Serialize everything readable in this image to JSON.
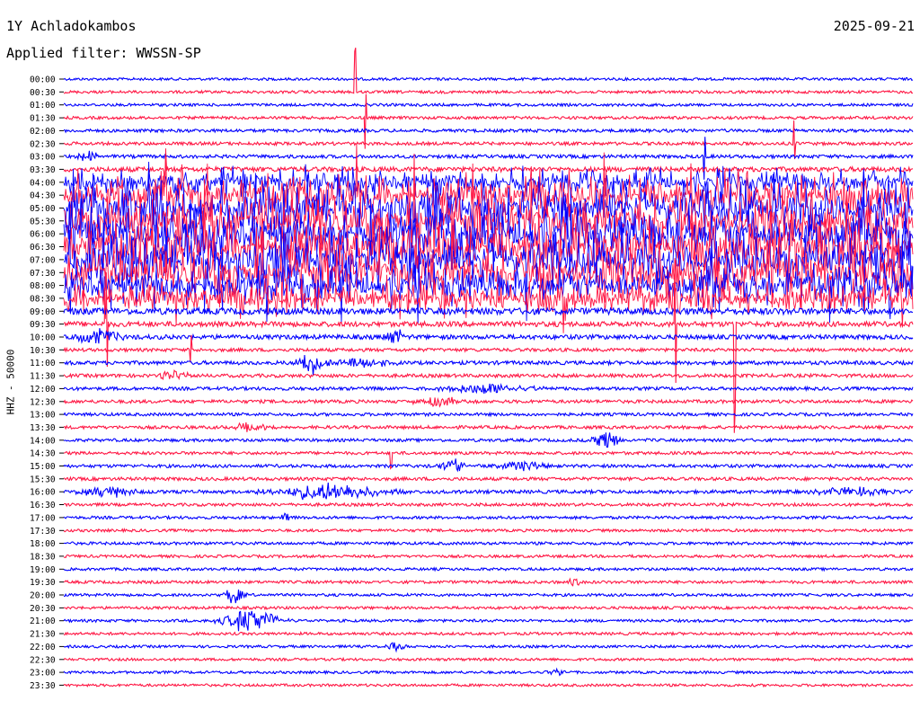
{
  "header": {
    "station": "1Y Achladokambos",
    "date": "2025-09-21",
    "filter": "Applied filter: WWSSN-SP"
  },
  "chart_data": {
    "type": "line",
    "channel_label": "HHZ - 50000",
    "colors": {
      "even_row": "#0000ff",
      "odd_row": "#ff1744"
    },
    "time_labels": [
      "00:00",
      "00:30",
      "01:00",
      "01:30",
      "02:00",
      "02:30",
      "03:00",
      "03:30",
      "04:00",
      "04:30",
      "05:00",
      "05:30",
      "06:00",
      "06:30",
      "07:00",
      "07:30",
      "08:00",
      "08:30",
      "09:00",
      "09:30",
      "10:00",
      "10:30",
      "11:00",
      "11:30",
      "12:00",
      "12:30",
      "13:00",
      "13:30",
      "14:00",
      "14:30",
      "15:00",
      "15:30",
      "16:00",
      "16:30",
      "17:00",
      "17:30",
      "18:00",
      "18:30",
      "19:00",
      "19:30",
      "20:00",
      "20:30",
      "21:00",
      "21:30",
      "22:00",
      "22:30",
      "23:00",
      "23:30"
    ],
    "row_activity": [
      0.15,
      0.2,
      0.2,
      0.25,
      0.35,
      0.35,
      0.45,
      0.9,
      1.8,
      3.0,
      3.8,
      4.0,
      4.0,
      4.0,
      4.0,
      4.0,
      3.0,
      2.2,
      1.5,
      1.0,
      0.8,
      0.4,
      0.55,
      0.45,
      0.4,
      0.4,
      0.3,
      0.35,
      0.3,
      0.3,
      0.35,
      0.4,
      0.45,
      0.3,
      0.25,
      0.2,
      0.25,
      0.2,
      0.2,
      0.25,
      0.2,
      0.2,
      0.2,
      0.2,
      0.15,
      0.15,
      0.15,
      0.15
    ],
    "events": [
      {
        "row": 6,
        "x": 0.03,
        "amp": 6,
        "width": 0.01
      },
      {
        "row": 20,
        "x": 0.04,
        "amp": 8,
        "width": 0.02
      },
      {
        "row": 20,
        "x": 0.39,
        "amp": 9,
        "width": 0.008
      },
      {
        "row": 22,
        "x": 0.29,
        "amp": 13,
        "width": 0.012
      },
      {
        "row": 22,
        "x": 0.35,
        "amp": 5,
        "width": 0.03
      },
      {
        "row": 23,
        "x": 0.13,
        "amp": 5,
        "width": 0.015
      },
      {
        "row": 24,
        "x": 0.5,
        "amp": 6,
        "width": 0.04
      },
      {
        "row": 25,
        "x": 0.44,
        "amp": 6,
        "width": 0.02
      },
      {
        "row": 27,
        "x": 0.22,
        "amp": 5,
        "width": 0.015
      },
      {
        "row": 28,
        "x": 0.64,
        "amp": 11,
        "width": 0.012
      },
      {
        "row": 30,
        "x": 0.46,
        "amp": 7,
        "width": 0.015
      },
      {
        "row": 30,
        "x": 0.54,
        "amp": 6,
        "width": 0.02
      },
      {
        "row": 32,
        "x": 0.05,
        "amp": 6,
        "width": 0.025
      },
      {
        "row": 32,
        "x": 0.31,
        "amp": 9,
        "width": 0.05
      },
      {
        "row": 32,
        "x": 0.93,
        "amp": 5,
        "width": 0.03
      },
      {
        "row": 34,
        "x": 0.26,
        "amp": 6,
        "width": 0.004
      },
      {
        "row": 39,
        "x": 0.6,
        "amp": 10,
        "width": 0.006
      },
      {
        "row": 40,
        "x": 0.2,
        "amp": 11,
        "width": 0.008
      },
      {
        "row": 42,
        "x": 0.22,
        "amp": 13,
        "width": 0.025
      },
      {
        "row": 44,
        "x": 0.39,
        "amp": 4,
        "width": 0.01
      },
      {
        "row": 46,
        "x": 0.58,
        "amp": 4,
        "width": 0.01
      }
    ],
    "spikes": [
      {
        "row": 1,
        "x": 0.343,
        "amp": 55
      },
      {
        "row": 3,
        "x": 0.355,
        "amp": 38
      },
      {
        "row": 5,
        "x": 0.86,
        "amp": 30
      },
      {
        "row": 6,
        "x": 0.755,
        "amp": 25
      },
      {
        "row": 7,
        "x": 0.12,
        "amp": 28
      },
      {
        "row": 19,
        "x": 0.05,
        "amp": 70
      },
      {
        "row": 19,
        "x": 0.72,
        "amp": 95
      },
      {
        "row": 19,
        "x": 0.79,
        "amp": 135
      },
      {
        "row": 21,
        "x": 0.15,
        "amp": 20
      },
      {
        "row": 29,
        "x": 0.385,
        "amp": 18
      }
    ]
  }
}
